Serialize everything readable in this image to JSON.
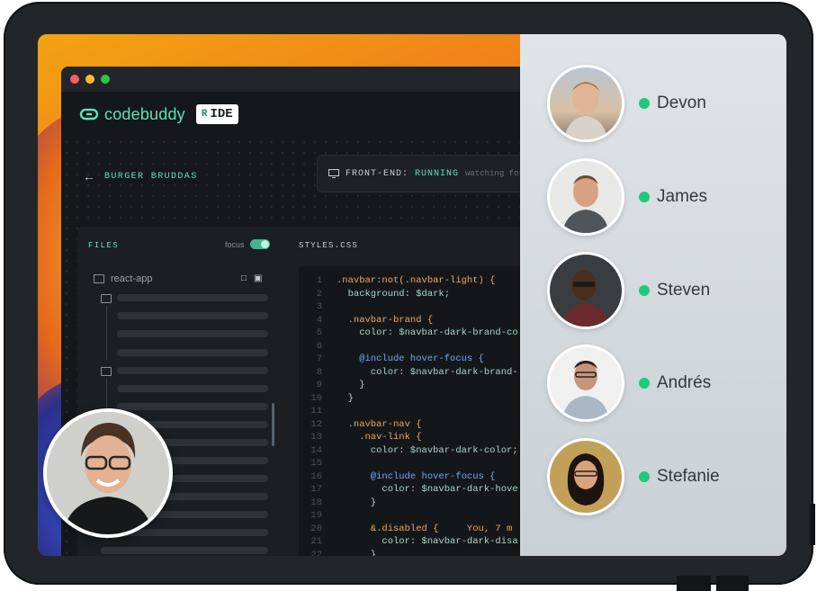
{
  "colors": {
    "accent": "#5fe0b3",
    "online": "#1fc97a",
    "editor_bg": "#14171a",
    "keyword": "#6fa8ff",
    "selector": "#f0a55b"
  },
  "window": {
    "brand": "codebuddy",
    "ide_badge": "IDE",
    "ide_mark": "R",
    "project": "BURGER BRUDDAS",
    "status_label": "FRONT-END:",
    "status_value": "RUNNING",
    "status_note": "watching for"
  },
  "files": {
    "header": "FILES",
    "focus_label": "focus",
    "root": "react-app"
  },
  "editor": {
    "filename": "STYLES.CSS",
    "lines": [
      {
        "n": "1",
        "text": ".navbar:not(.navbar-light) {"
      },
      {
        "n": "2",
        "text": "  background: $dark;"
      },
      {
        "n": "3",
        "text": ""
      },
      {
        "n": "4",
        "text": "  .navbar-brand {"
      },
      {
        "n": "5",
        "text": "    color: $navbar-dark-brand-co"
      },
      {
        "n": "6",
        "text": ""
      },
      {
        "n": "7",
        "text": "    @include hover-focus {"
      },
      {
        "n": "8",
        "text": "      color: $navbar-dark-brand-"
      },
      {
        "n": "9",
        "text": "    }"
      },
      {
        "n": "10",
        "text": "  }"
      },
      {
        "n": "11",
        "text": ""
      },
      {
        "n": "12",
        "text": "  .navbar-nav {"
      },
      {
        "n": "13",
        "text": "    .nav-link {"
      },
      {
        "n": "14",
        "text": "      color: $navbar-dark-color;"
      },
      {
        "n": "15",
        "text": ""
      },
      {
        "n": "16",
        "text": "      @include hover-focus {"
      },
      {
        "n": "17",
        "text": "        color: $navbar-dark-hove"
      },
      {
        "n": "18",
        "text": "      }"
      },
      {
        "n": "19",
        "text": ""
      },
      {
        "n": "20",
        "text": "      &.disabled {     You, 7 m"
      },
      {
        "n": "21",
        "text": "        color: $navbar-dark-disa"
      },
      {
        "n": "22",
        "text": "      }"
      }
    ]
  },
  "participants": [
    {
      "name": "Devon"
    },
    {
      "name": "James"
    },
    {
      "name": "Steven"
    },
    {
      "name": "Andrés"
    },
    {
      "name": "Stefanie"
    }
  ]
}
